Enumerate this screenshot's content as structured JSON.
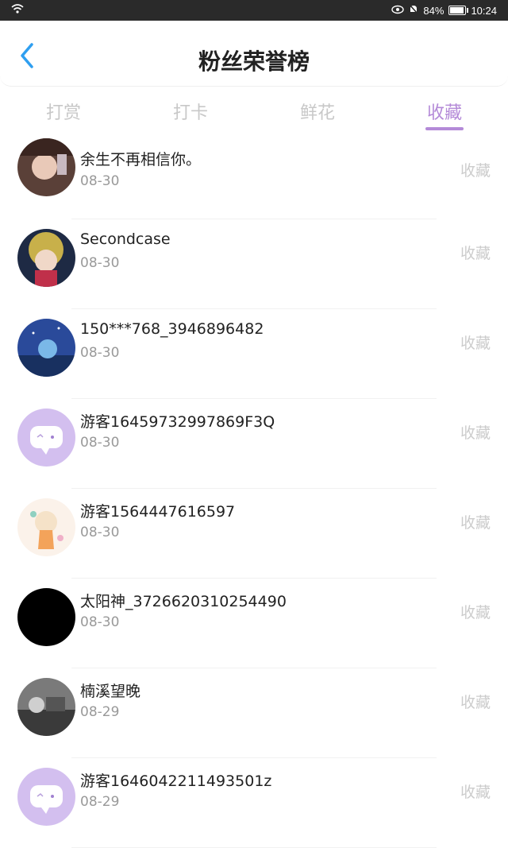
{
  "status": {
    "battery": "84%",
    "time": "10:24"
  },
  "header": {
    "title": "粉丝荣誉榜"
  },
  "tabs": [
    {
      "label": "打赏",
      "active": false
    },
    {
      "label": "打卡",
      "active": false
    },
    {
      "label": "鲜花",
      "active": false
    },
    {
      "label": "收藏",
      "active": true
    }
  ],
  "list": [
    {
      "name": "余生不再相信你。",
      "date": "08-30",
      "action": "收藏"
    },
    {
      "name": "Secondcase",
      "date": "08-30",
      "action": "收藏"
    },
    {
      "name": "150***768_3946896482",
      "date": "08-30",
      "action": "收藏"
    },
    {
      "name": "游客16459732997869F3Q",
      "date": "08-30",
      "action": "收藏"
    },
    {
      "name": "游客1564447616597",
      "date": "08-30",
      "action": "收藏"
    },
    {
      "name": "太阳神_372662031025449​0",
      "date": "08-30",
      "action": "收藏"
    },
    {
      "name": "楠溪望晚",
      "date": "08-29",
      "action": "收藏"
    },
    {
      "name": "游客1646042211493501z",
      "date": "08-29",
      "action": "收藏"
    }
  ],
  "colors": {
    "accent": "#b48ad8",
    "muted": "#cccccc",
    "tab_inactive": "#c8c8c8"
  }
}
